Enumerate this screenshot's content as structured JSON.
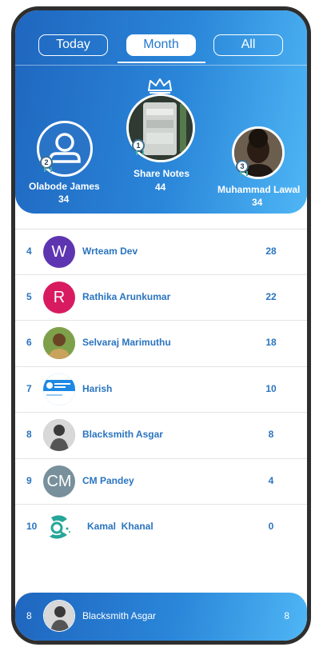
{
  "tabs": [
    {
      "label": "Today",
      "active": false
    },
    {
      "label": "Month",
      "active": true
    },
    {
      "label": "All",
      "active": false
    }
  ],
  "top3": {
    "first": {
      "rank": "1",
      "name": "Share Notes",
      "score": "44"
    },
    "second": {
      "rank": "2",
      "name": "Olabode James",
      "score": "34"
    },
    "third": {
      "rank": "3",
      "name": "Muhammad Lawal",
      "score": "34"
    }
  },
  "list": [
    {
      "rank": "4",
      "initial": "W",
      "avatar_color": "#5e35b1",
      "name": "Wrteam Dev",
      "score": "28"
    },
    {
      "rank": "5",
      "initial": "R",
      "avatar_color": "#d81b60",
      "name": "Rathika Arunkumar",
      "score": "22"
    },
    {
      "rank": "6",
      "initial": "",
      "avatar_color": "#6a8f3a",
      "name": "Selvaraj Marimuthu",
      "score": "18"
    },
    {
      "rank": "7",
      "initial": "",
      "avatar_color": "#1e88e5",
      "name": "Harish",
      "score": "10"
    },
    {
      "rank": "8",
      "initial": "",
      "avatar_color": "#8a8a8a",
      "name": "Blacksmith Asgar",
      "score": "8"
    },
    {
      "rank": "9",
      "initial": "CM",
      "avatar_color": "#78909c",
      "name": "CM Pandey",
      "score": "4"
    },
    {
      "rank": "10",
      "initial": "",
      "avatar_color": "#ffffff",
      "name": "Kamal  Khanal",
      "score": "0"
    }
  ],
  "current_user": {
    "rank": "8",
    "name": "Blacksmith Asgar",
    "score": "8"
  },
  "colors": {
    "accent": "#2a74bf",
    "header_start": "#1f66bf",
    "header_end": "#4fb6f5"
  }
}
